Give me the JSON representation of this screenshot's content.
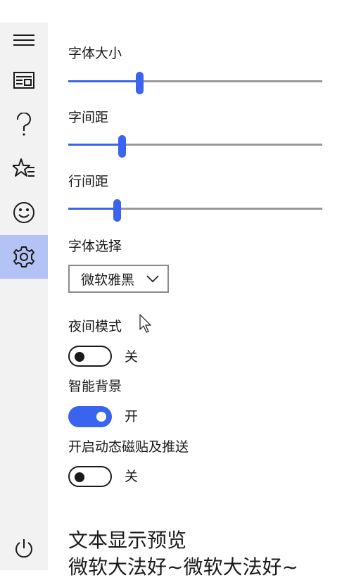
{
  "sidebar": {
    "items": [
      {
        "name": "menu",
        "icon": "hamburger-icon"
      },
      {
        "name": "reader",
        "icon": "newspaper-icon"
      },
      {
        "name": "help",
        "icon": "question-icon"
      },
      {
        "name": "favorites",
        "icon": "star-list-icon"
      },
      {
        "name": "emoji",
        "icon": "smiley-icon"
      },
      {
        "name": "settings",
        "icon": "gear-icon",
        "active": true
      },
      {
        "name": "power",
        "icon": "power-icon"
      }
    ]
  },
  "settings": {
    "font_size": {
      "label": "字体大小",
      "value": 0.28
    },
    "letter_spacing": {
      "label": "字间距",
      "value": 0.21
    },
    "line_spacing": {
      "label": "行间距",
      "value": 0.19
    },
    "font_select": {
      "label": "字体选择",
      "value": "微软雅黑"
    },
    "night_mode": {
      "label": "夜间模式",
      "state": "关",
      "on": false
    },
    "smart_bg": {
      "label": "智能背景",
      "state": "开",
      "on": true
    },
    "live_tile": {
      "label": "开启动态磁贴及推送",
      "state": "关",
      "on": false
    }
  },
  "preview": {
    "title": "文本显示预览",
    "text": "微软大法好~微软大法好~"
  },
  "colors": {
    "accent": "#3a63f0",
    "sidebar_bg": "#f2f2f2",
    "active_bg": "#b3c3f5"
  }
}
